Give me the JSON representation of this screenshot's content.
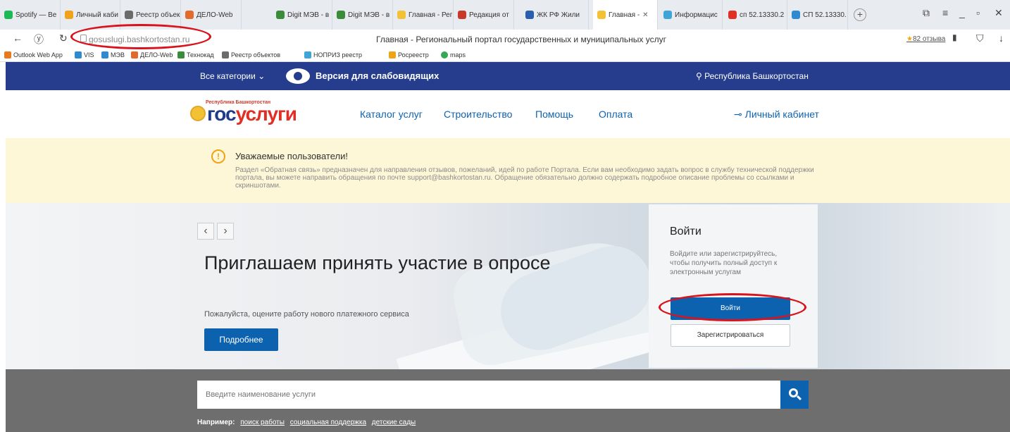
{
  "browser": {
    "tabs": [
      {
        "label": "Spotify — Be",
        "color": "#1db954"
      },
      {
        "label": "Личный каби",
        "color": "#f0a316"
      },
      {
        "label": "Реестр объек",
        "color": "#6b6b6b"
      },
      {
        "label": "ДЕЛО-Web",
        "color": "#e26b2b"
      },
      {
        "label": "Digit МЭВ - в",
        "color": "#3a8c3a"
      },
      {
        "label": "Digit МЭВ - в",
        "color": "#3a8c3a"
      },
      {
        "label": "Главная - Рег",
        "color": "#f3c234"
      },
      {
        "label": "Редакция от",
        "color": "#c73a2a"
      },
      {
        "label": "ЖК РФ Жили",
        "color": "#2a5fb0"
      },
      {
        "label": "Главная -",
        "color": "#f3c234"
      },
      {
        "label": "Информацис",
        "color": "#3fa5d8"
      },
      {
        "label": "сп 52.13330.2",
        "color": "#e03026"
      },
      {
        "label": "СП 52.13330.",
        "color": "#2f8bd1"
      }
    ],
    "url": "gosuslugi.bashkortostan.ru",
    "page_title": "Главная - Региональный портал государственных и муниципальных услуг",
    "reviews": "82 отзыва",
    "bookmarks": [
      {
        "label": "Outlook Web App",
        "color": "#e87a1e"
      },
      {
        "label": "VIS",
        "color": "#2f8bd1"
      },
      {
        "label": "МЭВ",
        "color": "#2f8bd1"
      },
      {
        "label": "ДЕЛО-Web",
        "color": "#e26b2b"
      },
      {
        "label": "Технокад",
        "color": "#3a8c3a"
      },
      {
        "label": "Реестр объектов",
        "color": "#6b6b6b"
      },
      {
        "label": "НОПРИЗ реестр",
        "color": "#3fa5d8"
      },
      {
        "label": "Росреестр",
        "color": "#f0a316"
      },
      {
        "label": "maps",
        "color": "#34a853"
      }
    ]
  },
  "topbar": {
    "categories": "Все категории",
    "vision": "Версия для слабовидящих",
    "region": "Республика Башкортостан"
  },
  "header": {
    "logo_sub": "Республика Башкортостан",
    "logo_g": "гос",
    "logo_r": "услуги",
    "menu": [
      "Каталог услуг",
      "Строительство",
      "Помощь",
      "Оплата"
    ],
    "cabinet": "Личный кабинет"
  },
  "notice": {
    "title": "Уважаемые пользователи!",
    "text": "Раздел «Обратная связь» предназначен для направления отзывов, пожеланий, идей по работе Портала. Если вам необходимо задать вопрос в службу технической поддержки портала, вы можете направить обращения по почте support@bashkortostan.ru. Обращение обязательно должно содержать подробное описание проблемы со ссылками и скриншотами."
  },
  "hero": {
    "title": "Приглашаем принять участие в опросе",
    "subtitle": "Пожалуйста, оцените работу нового платежного сервиса",
    "button": "Подробнее"
  },
  "login": {
    "title": "Войти",
    "text": "Войдите или зарегистрируйтесь, чтобы получить полный доступ к электронным услугам",
    "login_button": "Войти",
    "register_button": "Зарегистрироваться"
  },
  "search": {
    "placeholder": "Введите наименование услуги",
    "examples_label": "Например:",
    "examples": [
      "поиск работы",
      "социальная поддержка",
      "детские сады"
    ]
  },
  "colors": {
    "brand_blue": "#253d8c",
    "link_blue": "#0d62b0",
    "annotation_red": "#d9131c"
  }
}
